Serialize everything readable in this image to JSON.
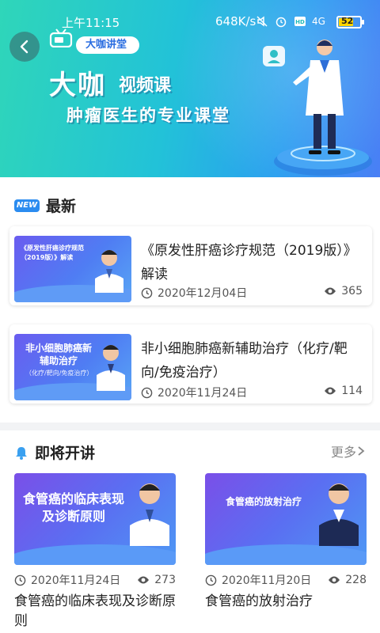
{
  "status_bar": {
    "time": "上午11:15",
    "net_speed": "648K/s",
    "signal": "4G",
    "battery": "52"
  },
  "banner": {
    "label": "大咖讲堂",
    "title_big": "大咖",
    "title_small": "视频课",
    "slogan": "肿瘤医生的专业课堂"
  },
  "latest": {
    "badge": "NEW",
    "title": "最新",
    "items": [
      {
        "title": "《原发性肝癌诊疗规范（2019版）》解读",
        "date": "2020年12月04日",
        "views": "365",
        "thumb_title": "《原发性肝癌诊疗规范（2019版）》解读"
      },
      {
        "title": "非小细胞肺癌新辅助治疗（化疗/靶向/免疫治疗）",
        "date": "2020年11月24日",
        "views": "114",
        "thumb_title": "非小细胞肺癌新辅助治疗",
        "thumb_sub": "（化疗/靶向/免疫治疗）"
      }
    ]
  },
  "upcoming": {
    "title": "即将开讲",
    "more": "更多",
    "items": [
      {
        "title": "食管癌的临床表现及诊断原则",
        "date": "2020年11月24日",
        "views": "273",
        "thumb_title": "食管癌的临床表现及诊断原则"
      },
      {
        "title": "食管癌的放射治疗",
        "date": "2020年11月20日",
        "views": "228",
        "thumb_title": "食管癌的放射治疗"
      }
    ]
  },
  "colors": {
    "accent": "#2b8cf0",
    "banner_start": "#2fd6b9",
    "banner_end": "#4a7ff5",
    "bell": "#3aa0f0"
  },
  "icons": {
    "back": "back-arrow-icon",
    "clock": "clock-icon",
    "eye": "eye-icon",
    "bell": "bell-icon",
    "chevron": "chevron-right-icon"
  }
}
